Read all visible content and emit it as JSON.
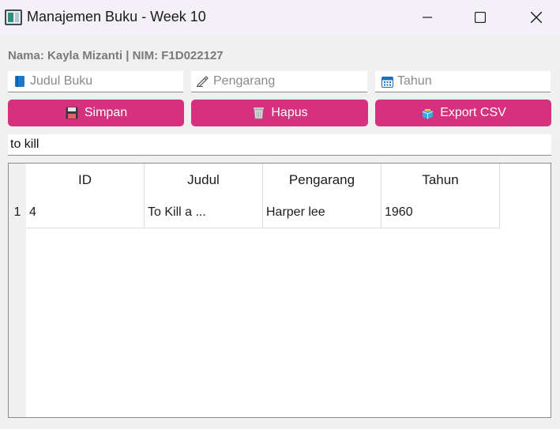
{
  "window": {
    "title": "Manajemen Buku - Week 10"
  },
  "header": {
    "nim_text": "Nama: Kayla Mizanti | NIM: F1D022127"
  },
  "form": {
    "judul_placeholder": "Judul Buku",
    "pengarang_placeholder": "Pengarang",
    "tahun_placeholder": "Tahun",
    "judul_icon": "book-icon",
    "pengarang_icon": "writing-hand-icon",
    "tahun_icon": "calendar-icon"
  },
  "buttons": {
    "simpan_label": "Simpan",
    "hapus_label": "Hapus",
    "export_label": "Export CSV",
    "accent_color": "#d6317f"
  },
  "search": {
    "value": "to kill"
  },
  "table": {
    "columns": [
      "ID",
      "Judul",
      "Pengarang",
      "Tahun"
    ],
    "rows": [
      {
        "row_number": "1",
        "cells": [
          "4",
          "To Kill a ...",
          "Harper lee",
          "1960"
        ]
      }
    ]
  }
}
